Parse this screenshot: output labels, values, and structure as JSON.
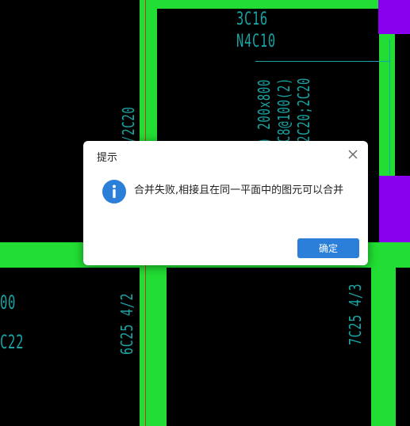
{
  "dialog": {
    "title": "提示",
    "message": "合并失败,相接且在同一平面中的图元可以合并",
    "ok_label": "确定"
  },
  "icons": {
    "close": "close-icon",
    "info": "info-icon"
  },
  "cad_labels": {
    "top_rebar": "3C16",
    "top_stirrup": "N4C10",
    "vertical_section": ") 200x800",
    "vertical_stirrup": "C8@100(2)",
    "vertical_long": "2C20;2C20",
    "left_vertical": "/2C20",
    "bottom_left_a": "00",
    "bottom_left_b": "C22",
    "bottom_middle": "6C25 4/2",
    "bottom_right": "7C25 4/3"
  },
  "colors": {
    "canvas_bg": "#000000",
    "element_green": "#22dd33",
    "element_purple": "#8800ee",
    "cad_text": "#1aa3a3",
    "axis_red": "#cc3322",
    "dialog_bg": "#ffffff",
    "primary_button": "#2b7fd9"
  }
}
